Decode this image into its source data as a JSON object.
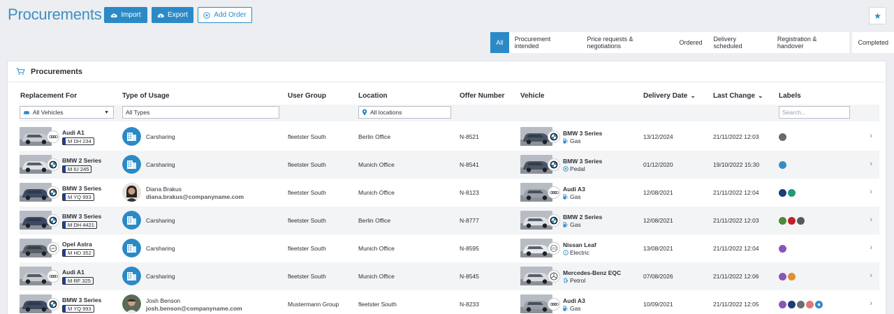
{
  "header": {
    "title": "Procurements",
    "import_label": "Import",
    "export_label": "Export",
    "add_order_label": "Add Order",
    "star_icon": "star-icon"
  },
  "status_tabs": [
    "All",
    "Procurement intended",
    "Price requests & negotiations",
    "Ordered",
    "Delivery scheduled",
    "Registration & handover",
    "Completed"
  ],
  "active_tab": "All",
  "card": {
    "title": "Procurements",
    "icon": "cart-icon"
  },
  "columns": {
    "replacement": "Replacement For",
    "usage": "Type of Usage",
    "group": "User Group",
    "location": "Location",
    "offer": "Offer Number",
    "vehicle": "Vehicle",
    "delivery": "Delivery Date",
    "last_change": "Last Change",
    "labels": "Labels"
  },
  "filters": {
    "vehicles": "All Vehicles",
    "types": "All Types",
    "locations": "All locations",
    "labels_placeholder": "Search..."
  },
  "rows": [
    {
      "repl_model": "Audi A1",
      "repl_plate": "M DH 234",
      "repl_brand": "audi",
      "repl_color": "#c7ccd2",
      "usage_name": "Carsharing",
      "usage_email": "",
      "usage_type": "carsharing",
      "group": "fleetster South",
      "location": "Berlin Office",
      "offer": "N-8521",
      "veh_model": "BMW 3 Series",
      "veh_fuel": "Gas",
      "veh_brand": "bmw",
      "veh_color": "#4a5566",
      "fuel_icon": "fuel-pump-icon",
      "delivery": "13/12/2024",
      "last_change": "21/11/2022 12:03",
      "labels": [
        "#666a70"
      ]
    },
    {
      "repl_model": "BMW 2 Series",
      "repl_plate": "M IU 245",
      "repl_brand": "bmw",
      "repl_color": "#dfe3e8",
      "usage_name": "Carsharing",
      "usage_email": "",
      "usage_type": "carsharing",
      "group": "fleetster South",
      "location": "Munich Office",
      "offer": "N-8541",
      "veh_model": "BMW 3 Series",
      "veh_fuel": "Pedal",
      "veh_brand": "bmw",
      "veh_color": "#4a5566",
      "fuel_icon": "pedal-icon",
      "delivery": "01/12/2020",
      "last_change": "19/10/2022 15:30",
      "labels": [
        "#3a8dc0"
      ]
    },
    {
      "repl_model": "BMW 3 Series",
      "repl_plate": "M YQ 993",
      "repl_brand": "bmw",
      "repl_color": "#3c4a66",
      "usage_name": "Diana Brakus",
      "usage_email": "diana.brakus@companyname.com",
      "usage_type": "person-f",
      "group": "fleetster South",
      "location": "Munich Office",
      "offer": "N-8123",
      "veh_model": "Audi A3",
      "veh_fuel": "Gas",
      "veh_brand": "audi",
      "veh_color": "#9aa0a8",
      "fuel_icon": "fuel-pump-icon",
      "delivery": "12/08/2021",
      "last_change": "21/11/2022 12:04",
      "labels": [
        "#1e3c7a",
        "#1f9a7a"
      ]
    },
    {
      "repl_model": "BMW 3 Series",
      "repl_plate": "M DH 4421",
      "repl_brand": "bmw",
      "repl_color": "#3c4a66",
      "usage_name": "Carsharing",
      "usage_email": "",
      "usage_type": "carsharing",
      "group": "fleetster South",
      "location": "Berlin Office",
      "offer": "N-8777",
      "veh_model": "BMW 2 Series",
      "veh_fuel": "Gas",
      "veh_brand": "bmw",
      "veh_color": "#dfe3e8",
      "fuel_icon": "fuel-pump-icon",
      "delivery": "12/08/2021",
      "last_change": "21/11/2022 12:03",
      "labels": [
        "#4b8a3a",
        "#c0202a",
        "#555a60"
      ]
    },
    {
      "repl_model": "Opel Astra",
      "repl_plate": "M HD 352",
      "repl_brand": "opel",
      "repl_color": "#5a606a",
      "usage_name": "Carsharing",
      "usage_email": "",
      "usage_type": "carsharing",
      "group": "fleetster South",
      "location": "Munich Office",
      "offer": "N-8595",
      "veh_model": "Nissan Leaf",
      "veh_fuel": "Electric",
      "veh_brand": "nissan",
      "veh_color": "#e8ebee",
      "fuel_icon": "plug-icon",
      "delivery": "13/08/2021",
      "last_change": "21/11/2022 12:04",
      "labels": [
        "#8a55b8"
      ]
    },
    {
      "repl_model": "Audi A1",
      "repl_plate": "M RF 325",
      "repl_brand": "audi",
      "repl_color": "#c7ccd2",
      "usage_name": "Carsharing",
      "usage_email": "",
      "usage_type": "carsharing",
      "group": "fleetster South",
      "location": "Munich Office",
      "offer": "N-8545",
      "veh_model": "Mercedes-Benz EQC",
      "veh_fuel": "Petrol",
      "veh_brand": "mercedes",
      "veh_color": "#d8dce1",
      "fuel_icon": "petrol-icon",
      "delivery": "07/08/2026",
      "last_change": "21/11/2022 12:06",
      "labels": [
        "#8a55b8",
        "#e09030"
      ]
    },
    {
      "repl_model": "BMW 3 Series",
      "repl_plate": "M YQ 993",
      "repl_brand": "bmw",
      "repl_color": "#3c4a66",
      "usage_name": "Josh Benson",
      "usage_email": "josh.benson@companyname.com",
      "usage_type": "person-m",
      "group": "Mustermann Group",
      "location": "fleetster South",
      "offer": "N-8233",
      "veh_model": "Audi A3",
      "veh_fuel": "Gas",
      "veh_brand": "audi",
      "veh_color": "#9aa0a8",
      "fuel_icon": "fuel-pump-icon",
      "delivery": "10/09/2021",
      "last_change": "21/11/2022 12:05",
      "labels": [
        "#8a55b8",
        "#1e3c7a",
        "#6a6e74",
        "#e07878",
        "#2b8ac6"
      ]
    }
  ]
}
